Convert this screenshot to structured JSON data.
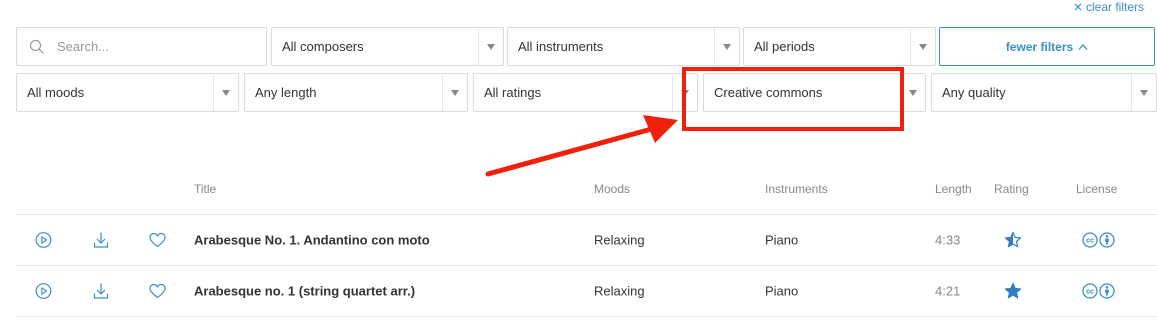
{
  "clear_filters": {
    "label": "clear filters"
  },
  "search": {
    "placeholder": "Search...",
    "value": ""
  },
  "filters_row1": {
    "composers": "All composers",
    "instruments": "All instruments",
    "periods": "All periods",
    "fewer_filters": "fewer filters"
  },
  "filters_row2": {
    "moods": "All moods",
    "length": "Any length",
    "ratings": "All ratings",
    "license": "Creative commons",
    "quality": "Any quality"
  },
  "table": {
    "headers": {
      "title": "Title",
      "moods": "Moods",
      "instruments": "Instruments",
      "length": "Length",
      "rating": "Rating",
      "license": "License"
    },
    "rows": [
      {
        "title": "Arabesque No. 1. Andantino con moto",
        "mood": "Relaxing",
        "instrument": "Piano",
        "length": "4:33",
        "rating_icon": "half-star-icon"
      },
      {
        "title": "Arabesque no. 1 (string quartet arr.)",
        "mood": "Relaxing",
        "instrument": "Piano",
        "length": "4:21",
        "rating_icon": "full-star-icon"
      }
    ]
  },
  "colors": {
    "accent": "#3a8fc7",
    "annotation": "#f0200c",
    "border": "#dcdcdc"
  }
}
